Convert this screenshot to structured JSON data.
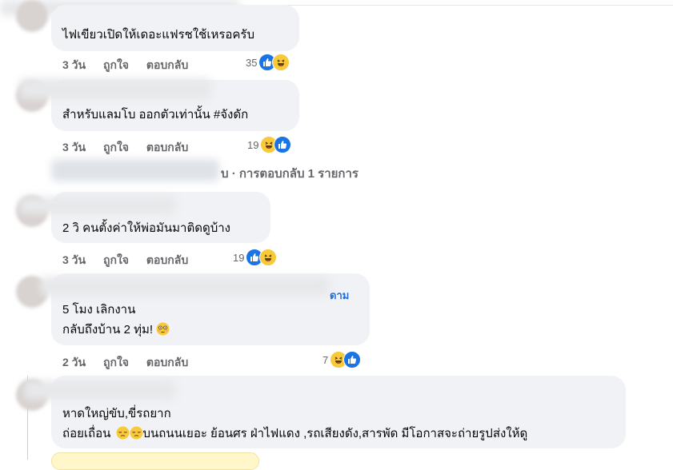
{
  "comments": [
    {
      "text_lines": [
        "ไฟเขียวเปิดให้เดอะแฟรชใช้เหรอครับ"
      ],
      "time": "3 วัน",
      "like": "ถูกใจ",
      "reply": "ตอบกลับ",
      "reaction_count": "35",
      "reactions": [
        "like-icon",
        "haha-icon"
      ]
    },
    {
      "text_lines": [
        "สำหรับแลมโบ ออกตัวเท่านั้น #จังดัก"
      ],
      "time": "3 วัน",
      "like": "ถูกใจ",
      "reply": "ตอบกลับ",
      "reaction_count": "19",
      "reactions": [
        "haha-icon",
        "like-icon"
      ]
    },
    {
      "text_lines": [
        "2 วิ คนตั้งค่าให้พ่อมันมาติดดูบ้าง"
      ],
      "time": "3 วัน",
      "like": "ถูกใจ",
      "reply": "ตอบกลับ",
      "reaction_count": "19",
      "reactions": [
        "like-icon",
        "haha-icon"
      ]
    },
    {
      "name_fragment": "ดาม",
      "text_lines": [
        "5 โมง เลิกงาน",
        "กลับถึงบ้าน 2 ทุ่ม!"
      ],
      "time": "2 วัน",
      "like": "ถูกใจ",
      "reply": "ตอบกลับ",
      "reaction_count": "7",
      "reactions": [
        "haha-icon",
        "like-icon"
      ]
    },
    {
      "text_lines": [
        "หาดใหญ่ขับ,ขี่รถยาก",
        "ถ่อยเถื่อน",
        "บนถนนเยอะ ย้อนศร ฝ่าไฟแดง ,รถเสียงดัง,สารพัด มีโอกาสจะถ่ายรูปส่งให้ดู"
      ]
    }
  ],
  "replies_link": "บ · การตอบกลับ 1 รายการ",
  "colors": {
    "like": "#1b74e4",
    "haha": "#f7c93b",
    "bubble": "#f0f2f5",
    "meta": "#65676b"
  }
}
